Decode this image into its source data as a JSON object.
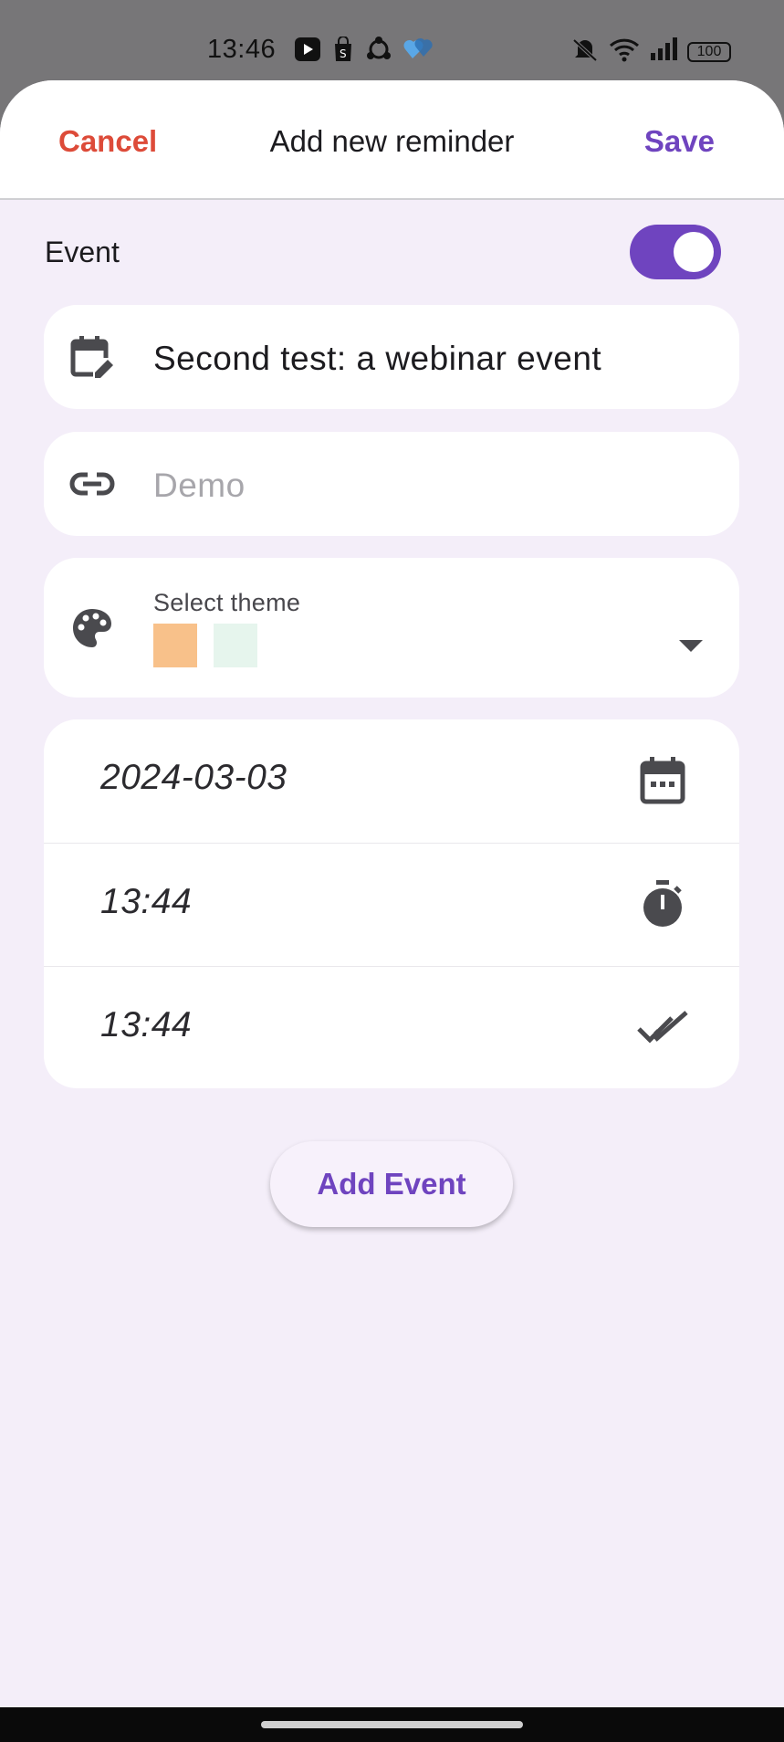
{
  "status_bar": {
    "time": "13:46",
    "battery": "100",
    "left_icons": [
      "video-app-icon",
      "shopping-bag-icon",
      "sync-icon",
      "hearts-icon"
    ],
    "right_icons": [
      "mute-icon",
      "wifi-icon",
      "signal-icon",
      "battery-icon"
    ]
  },
  "header": {
    "cancel_label": "Cancel",
    "title": "Add new reminder",
    "save_label": "Save"
  },
  "event_toggle": {
    "label": "Event",
    "on": true
  },
  "fields": {
    "title_value": "Second test:  a webinar event",
    "link_placeholder": "Demo",
    "theme_label": "Select theme",
    "theme_colors": [
      "#f8c18a",
      "#e6f5ed"
    ]
  },
  "schedule": {
    "date": "2024-03-03",
    "start_time": "13:44",
    "end_time": "13:44"
  },
  "add_event_label": "Add Event",
  "colors": {
    "accent": "#6f44bf",
    "cancel": "#dd4b39",
    "background": "#f4eef9"
  }
}
